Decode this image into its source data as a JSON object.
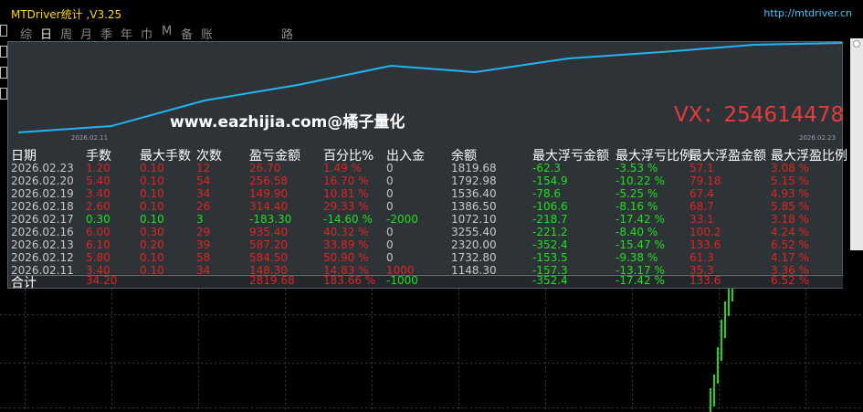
{
  "window": {
    "title": "MTDriver统计 ,V3.25",
    "url": "http://mtdriver.cn"
  },
  "tabs": [
    "综",
    "日",
    "周",
    "月",
    "季",
    "年",
    "巾",
    "M",
    "备",
    "账户",
    "路径"
  ],
  "active_tab": "日",
  "chart": {
    "start_label": "2026.02.11",
    "end_label": "2026.02.23",
    "line_color": "#22b4f0"
  },
  "watermark": "www.eazhijia.com@橘子量化",
  "vx": "VX：254614478",
  "colors": {
    "red": "#e02424",
    "green": "#1fe01f",
    "white": "#c8c8c8",
    "background": "#2e3338"
  },
  "table": {
    "headers": [
      "日期",
      "手数",
      "最大手数",
      "次数",
      "盈亏金额",
      "百分比%",
      "出入金",
      "余额",
      "最大浮亏金额",
      "最大浮亏比例",
      "最大浮盈金额",
      "最大浮盈比例"
    ],
    "rows": [
      {
        "date": "2026.02.23",
        "lots": "1.20",
        "maxlots": "0.10",
        "count": "12",
        "pl": "26.70",
        "pct": "1.49 %",
        "flow": "0",
        "bal": "1819.68",
        "fl": "-62.3",
        "flp": "-3.53 %",
        "fp": "57.1",
        "fpp": "3.08 %"
      },
      {
        "date": "2026.02.20",
        "lots": "5.40",
        "maxlots": "0.10",
        "count": "54",
        "pl": "256.58",
        "pct": "16.70 %",
        "flow": "0",
        "bal": "1792.98",
        "fl": "-154.9",
        "flp": "-10.22 %",
        "fp": "79.18",
        "fpp": "5.15 %"
      },
      {
        "date": "2026.02.19",
        "lots": "3.40",
        "maxlots": "0.10",
        "count": "34",
        "pl": "149.90",
        "pct": "10.81 %",
        "flow": "0",
        "bal": "1536.40",
        "fl": "-78.6",
        "flp": "-5.25 %",
        "fp": "67.4",
        "fpp": "4.93 %"
      },
      {
        "date": "2026.02.18",
        "lots": "2.60",
        "maxlots": "0.10",
        "count": "26",
        "pl": "314.40",
        "pct": "29.33 %",
        "flow": "0",
        "bal": "1386.50",
        "fl": "-106.6",
        "flp": "-8.16 %",
        "fp": "68.7",
        "fpp": "5.85 %"
      },
      {
        "date": "2026.02.17",
        "lots": "0.30",
        "maxlots": "0.10",
        "count": "3",
        "pl": "-183.30",
        "pct": "-14.60 %",
        "flow": "-2000",
        "bal": "1072.10",
        "fl": "-218.7",
        "flp": "-17.42 %",
        "fp": "33.1",
        "fpp": "3.18 %"
      },
      {
        "date": "2026.02.16",
        "lots": "6.00",
        "maxlots": "0.30",
        "count": "29",
        "pl": "935.40",
        "pct": "40.32 %",
        "flow": "0",
        "bal": "3255.40",
        "fl": "-221.2",
        "flp": "-8.40 %",
        "fp": "100.2",
        "fpp": "4.24 %"
      },
      {
        "date": "2026.02.13",
        "lots": "6.10",
        "maxlots": "0.20",
        "count": "39",
        "pl": "587.20",
        "pct": "33.89 %",
        "flow": "0",
        "bal": "2320.00",
        "fl": "-352.4",
        "flp": "-15.47 %",
        "fp": "133.6",
        "fpp": "6.52 %"
      },
      {
        "date": "2026.02.12",
        "lots": "5.80",
        "maxlots": "0.10",
        "count": "58",
        "pl": "584.50",
        "pct": "50.90 %",
        "flow": "0",
        "bal": "1732.80",
        "fl": "-153.5",
        "flp": "-9.38 %",
        "fp": "61.3",
        "fpp": "4.17 %"
      },
      {
        "date": "2026.02.11",
        "lots": "3.40",
        "maxlots": "0.10",
        "count": "34",
        "pl": "148.30",
        "pct": "14.83 %",
        "flow": "1000",
        "bal": "1148.30",
        "fl": "-157.3",
        "flp": "-13.17 %",
        "fp": "35.3",
        "fpp": "3.36 %"
      }
    ],
    "total": {
      "label": "合计",
      "lots": "34.20",
      "pl": "2819.68",
      "pct": "183.66 %",
      "flow": "-1000",
      "fl": "-352.4",
      "flp": "-17.42 %",
      "fp": "133.6",
      "fpp": "6.52 %"
    }
  }
}
